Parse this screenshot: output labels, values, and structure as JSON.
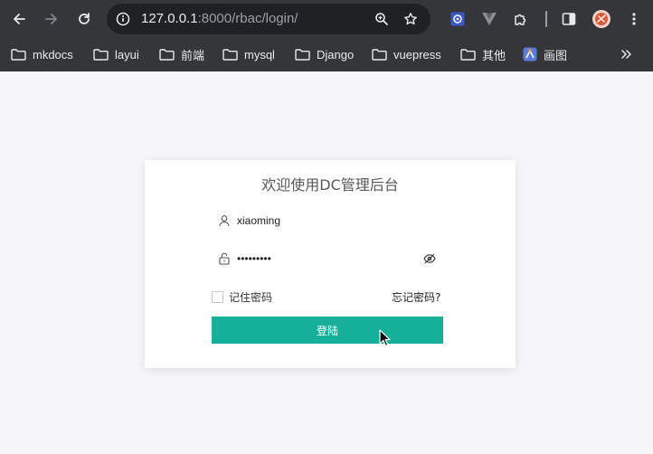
{
  "browser": {
    "url_host": "127.0.0.1",
    "url_rest": ":8000/rbac/login/",
    "extensions": [
      "vpn-extension",
      "vue-devtools",
      "puzzle-extensions",
      "sidebar-toggle",
      "profile-avatar",
      "more-menu"
    ]
  },
  "bookmarks": [
    {
      "label": "mkdocs"
    },
    {
      "label": "layui"
    },
    {
      "label": "前端"
    },
    {
      "label": "mysql"
    },
    {
      "label": "Django"
    },
    {
      "label": "vuepress"
    },
    {
      "label": "其他"
    },
    {
      "label": "画图"
    }
  ],
  "login": {
    "title": "欢迎使用DC管理后台",
    "username_value": "xiaoming",
    "password_value": "•••••••••",
    "remember_label": "记住密码",
    "forgot_label": "忘记密码?",
    "submit_label": "登陆"
  },
  "colors": {
    "chrome": "#35363a",
    "omnibox": "#202124",
    "page_background": "#f6f6f8",
    "button": "#16b09a"
  }
}
